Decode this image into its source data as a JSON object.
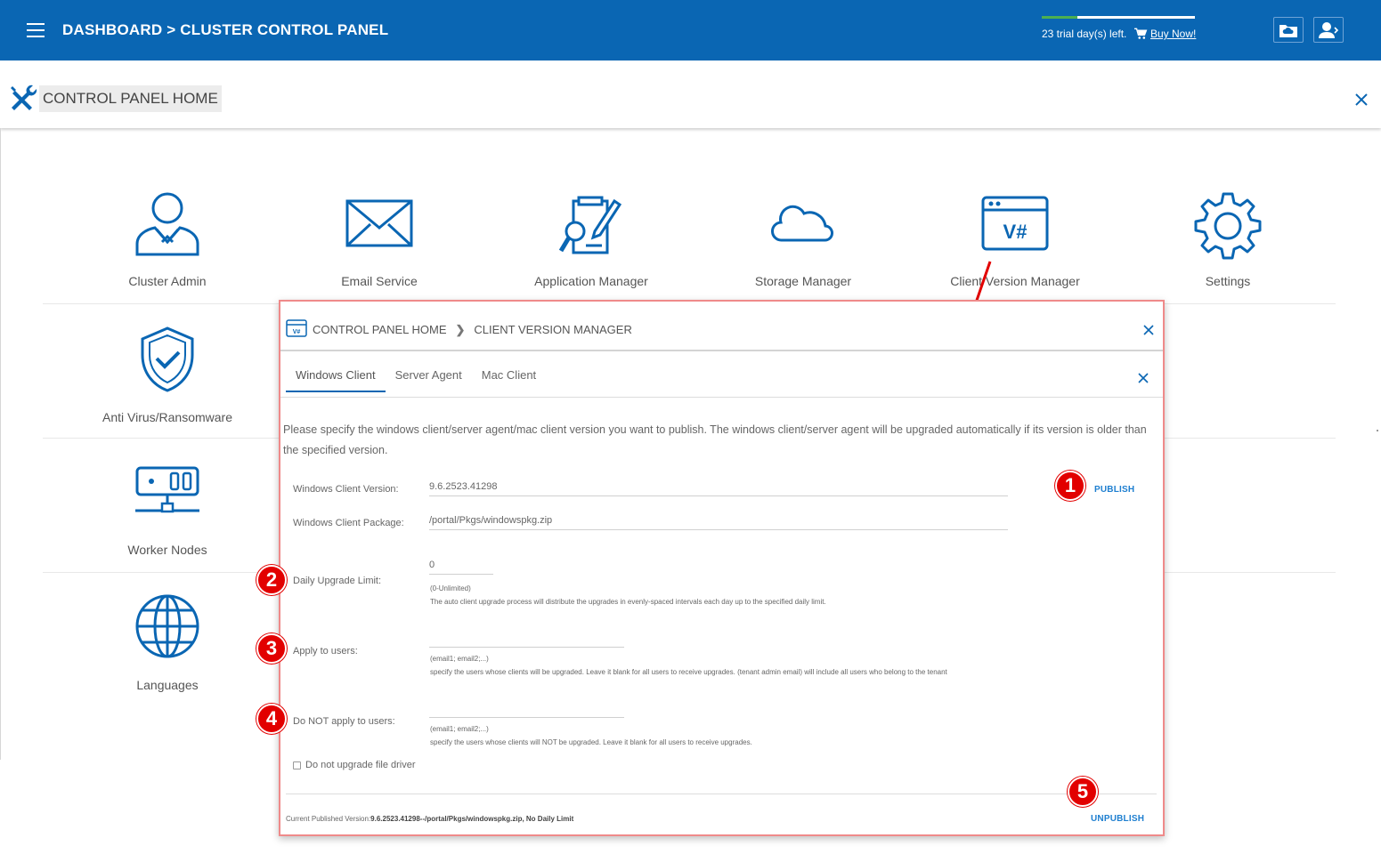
{
  "topbar": {
    "title": "DASHBOARD > CLUSTER CONTROL PANEL",
    "trial_text": "23 trial day(s) left.",
    "trial_progress": 0.23,
    "buy_label": "Buy Now!"
  },
  "panel": {
    "title": "CONTROL PANEL HOME"
  },
  "tiles": {
    "cluster_admin": "Cluster Admin",
    "email_service": "Email Service",
    "application_manager": "Application Manager",
    "storage_manager": "Storage Manager",
    "client_version_manager": "Client Version Manager",
    "settings": "Settings",
    "anti_virus": "Anti Virus/Ransomware",
    "worker_nodes": "Worker Nodes",
    "languages": "Languages"
  },
  "dialog": {
    "breadcrumb": [
      "CONTROL PANEL HOME",
      "CLIENT VERSION MANAGER"
    ],
    "tabs": [
      "Windows Client",
      "Server Agent",
      "Mac Client"
    ],
    "description": "Please specify the windows client/server agent/mac client version you want to publish. The windows client/server agent will be upgraded automatically if its version is older than the specified version.",
    "fields": {
      "version_label": "Windows Client Version:",
      "version_value": "9.6.2523.41298",
      "package_label": "Windows Client Package:",
      "package_value": "/portal/Pkgs/windowspkg.zip",
      "daily_label": "Daily Upgrade Limit:",
      "daily_value": "0",
      "daily_hint1": "(0-Unlimited)",
      "daily_hint2": "The auto client upgrade process will distribute the upgrades in evenly-spaced intervals each day up to the specified daily limit.",
      "apply_label": "Apply to users:",
      "apply_hint1": "(email1; email2;...)",
      "apply_hint2": "specify the users whose clients will be upgraded. Leave it blank for all users to receive upgrades. (tenant admin email) will include all users who belong to the tenant",
      "not_apply_label": "Do NOT apply to users:",
      "not_apply_hint1": "(email1; email2;...)",
      "not_apply_hint2": "specify the users whose clients will NOT be upgraded. Leave it blank for all users to receive upgrades."
    },
    "checkbox_label": "Do not upgrade file driver",
    "publish_label": "PUBLISH",
    "unpublish_label": "UNPUBLISH",
    "footer_prefix": "Current Published Version:",
    "footer_value": "9.6.2523.41298--/portal/Pkgs/windowspkg.zip, No Daily Limit"
  },
  "badges": [
    "1",
    "2",
    "3",
    "4",
    "5"
  ],
  "colors": {
    "brand": "#0a66b3",
    "link": "#1e7fd0",
    "badge": "#e20000",
    "highlight_border": "#ef8a8a",
    "trial_fill": "#4caf50"
  }
}
